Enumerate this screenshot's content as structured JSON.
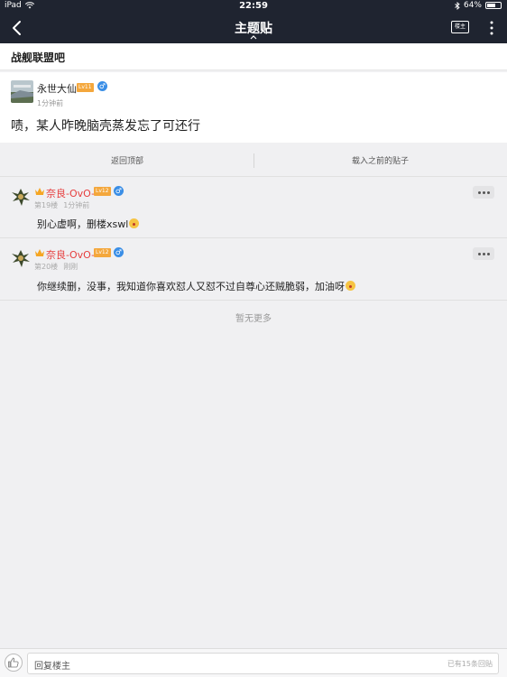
{
  "status_bar": {
    "device": "iPad",
    "time": "22:59",
    "battery_text": "64%",
    "battery_level": 0.64
  },
  "nav": {
    "title": "主题贴",
    "louzhu_label": "楼主"
  },
  "forum": {
    "name": "战舰联盟吧"
  },
  "main_post": {
    "author": "永世大仙",
    "level": "Lv11",
    "time": "1分钟前",
    "content": "啧，某人昨晚脑壳蒸发忘了可还行"
  },
  "actions": {
    "back_to_top": "返回顶部",
    "load_previous": "载入之前的贴子"
  },
  "replies": [
    {
      "author": "奈良-OvO-",
      "level": "Lv12",
      "floor": "第19楼",
      "time": "1分钟前",
      "content": "别心虚啊，删楼xswl"
    },
    {
      "author": "奈良-OvO-",
      "level": "Lv12",
      "floor": "第20楼",
      "time": "刚刚",
      "content": "你继续删，没事，我知道你喜欢怼人又怼不过自尊心还贼脆弱，加油呀"
    }
  ],
  "footer": {
    "no_more": "暂无更多",
    "reply_placeholder": "回复楼主",
    "reply_count": "已有15条回贴"
  },
  "colors": {
    "nav_bg": "#1f2430",
    "username_red": "#e63e3e",
    "level_orange": "#f4a73c",
    "male_blue": "#3a8ee6"
  }
}
